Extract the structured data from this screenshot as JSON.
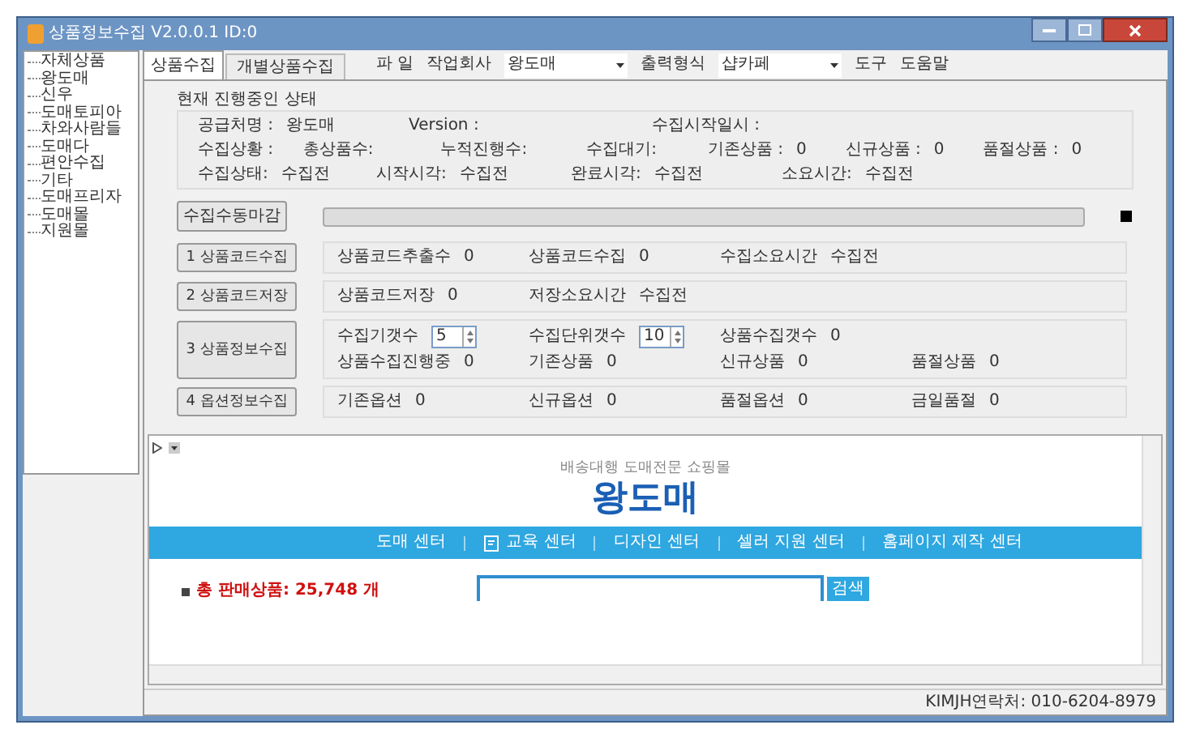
{
  "window": {
    "title": "상품정보수집 V2.0.0.1 ID:0"
  },
  "tree": {
    "items": [
      "자체상품",
      "왕도매",
      "신우",
      "도매토피아",
      "차와사람들",
      "도매다",
      "편안수집",
      "기타",
      "도매프리자",
      "도매몰",
      "지원몰"
    ]
  },
  "tabs": [
    {
      "label": "상품수집",
      "selected": true
    },
    {
      "label": "개별상품수집",
      "selected": false
    }
  ],
  "menu": {
    "file": "파 일",
    "company_label": "작업회사",
    "company_value": "왕도매",
    "output_label": "출력형식",
    "output_value": "샵카페",
    "tools": "도구",
    "help": "도움말"
  },
  "status_group": {
    "title": "현재 진행중인 상태",
    "lines": [
      {
        "fields": [
          {
            "label": "공급처명 :",
            "value": "왕도매"
          },
          {
            "label": "Version :"
          },
          {
            "label": "수집시작일시 :"
          }
        ]
      },
      {
        "fields": [
          {
            "label": "수집상황 :"
          },
          {
            "label": "총상품수:"
          },
          {
            "label": "누적진행수:"
          },
          {
            "label": "수집대기:"
          },
          {
            "label": "기존상품 :",
            "value": "0"
          },
          {
            "label": "신규상품 :",
            "value": "0"
          },
          {
            "label": "품절상품 :",
            "value": "0"
          }
        ]
      },
      {
        "fields": [
          {
            "label": "수집상태:",
            "value": "수집전"
          },
          {
            "label": "시작시각:",
            "value": "수집전"
          },
          {
            "label": "완료시각:",
            "value": "수집전"
          },
          {
            "label": "소요시간:",
            "value": "수집전"
          }
        ]
      }
    ]
  },
  "manual_close": {
    "label": "수집수동마감",
    "level": 0
  },
  "steps": [
    {
      "button": "1 상품코드수집",
      "lines": [
        {
          "fields": [
            {
              "kind": "text",
              "label": "상품코드추출수",
              "value": "0"
            },
            {
              "kind": "text",
              "label": "상품코드수집",
              "value": "0"
            },
            {
              "kind": "text",
              "label": "수집소요시간",
              "value": "수집전"
            }
          ]
        }
      ]
    },
    {
      "button": "2 상품코드저장",
      "lines": [
        {
          "fields": [
            {
              "kind": "text",
              "label": "상품코드저장",
              "value": "0"
            },
            {
              "kind": "text",
              "label": "저장소요시간",
              "value": "수집전"
            }
          ]
        }
      ]
    },
    {
      "button": "3 상품정보수집",
      "lines": [
        {
          "fields": [
            {
              "kind": "spinner",
              "label": "수집기갯수",
              "value": "5"
            },
            {
              "kind": "spinner",
              "label": "수집단위갯수",
              "value": "10"
            },
            {
              "kind": "text",
              "label": "상품수집갯수",
              "value": "0"
            }
          ]
        },
        {
          "fields": [
            {
              "kind": "text",
              "label": "상품수집진행중",
              "value": "0"
            },
            {
              "kind": "text",
              "label": "기존상품",
              "value": "0"
            },
            {
              "kind": "text",
              "label": "신규상품",
              "value": "0"
            },
            {
              "kind": "text",
              "label": "품절상품",
              "value": "0"
            }
          ]
        }
      ]
    },
    {
      "button": "4 옵션정보수집",
      "lines": [
        {
          "fields": [
            {
              "kind": "text",
              "label": "기존옵션",
              "value": "0"
            },
            {
              "kind": "text",
              "label": "신규옵션",
              "value": "0"
            },
            {
              "kind": "text",
              "label": "품절옵션",
              "value": "0"
            },
            {
              "kind": "text",
              "label": "금일품절",
              "value": "0"
            }
          ]
        }
      ]
    }
  ],
  "browser": {
    "tagline": "배송대행 도매전문 쇼핑몰",
    "logo": "왕도매",
    "nav": [
      {
        "label": "도매 센터",
        "has_icon": false
      },
      {
        "label": "교육 센터",
        "has_icon": true
      },
      {
        "label": "디자인 센터",
        "has_icon": false
      },
      {
        "label": "셀러 지원 센터",
        "has_icon": false
      },
      {
        "label": "홈페이지 제작 센터",
        "has_icon": false
      }
    ],
    "summary": "총 판매상품: 25,748 개",
    "search_button": "검색"
  },
  "status_bar": {
    "text": "KIMJH연락처: 010-6204-8979"
  }
}
